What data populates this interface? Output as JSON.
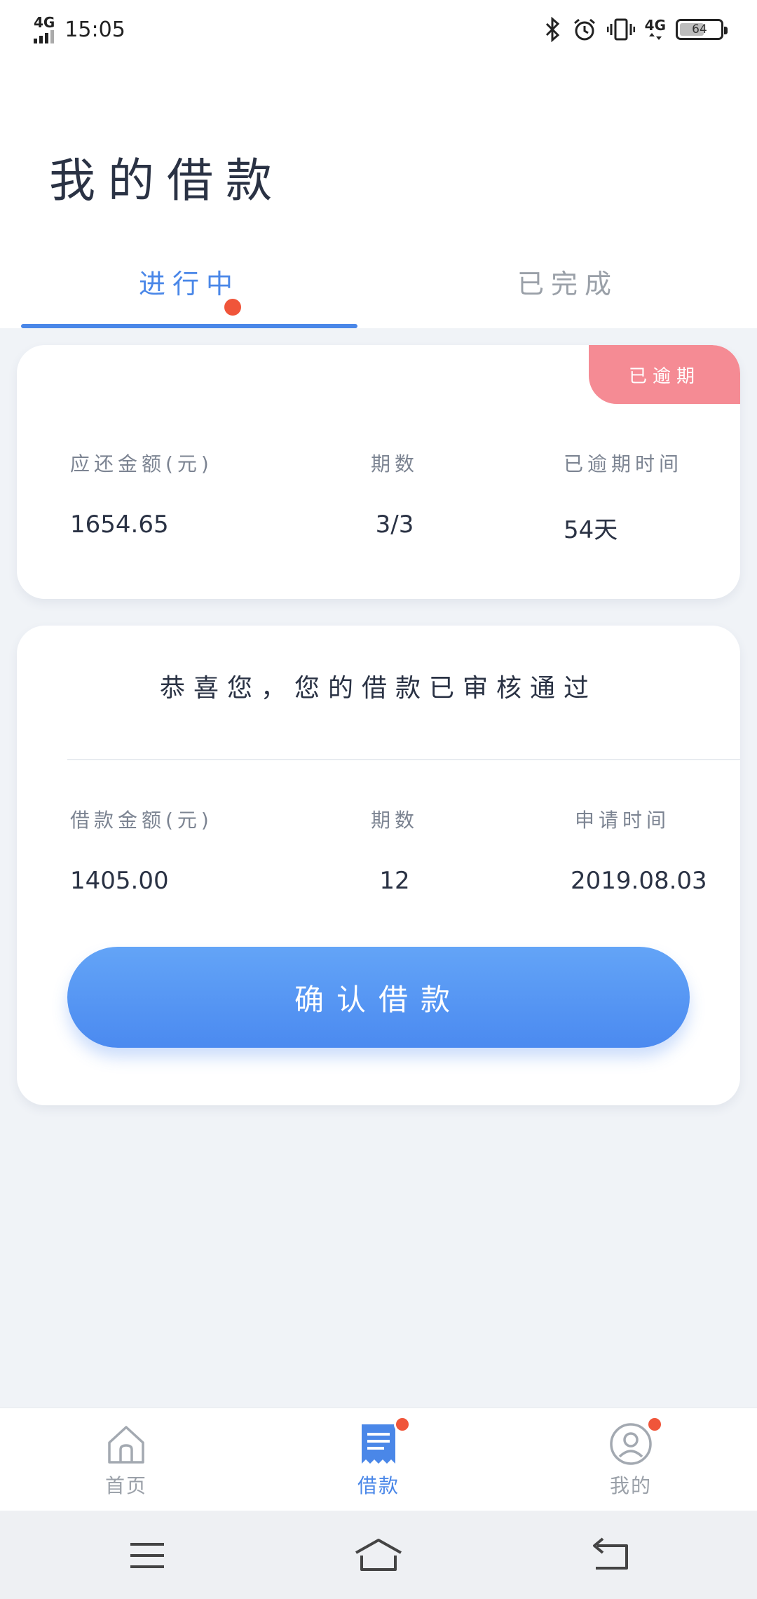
{
  "status_bar": {
    "network": "4G",
    "time": "15:05",
    "network_right": "4G",
    "battery": "64",
    "battery_level": 0.64
  },
  "header": {
    "title": "我的借款",
    "tabs": [
      {
        "label": "进行中",
        "active": true,
        "has_dot": true
      },
      {
        "label": "已完成",
        "active": false,
        "has_dot": false
      }
    ]
  },
  "overdue_card": {
    "badge": "已逾期",
    "columns": [
      {
        "label": "应还金额(元)",
        "value": "1654.65"
      },
      {
        "label": "期数",
        "value": "3/3"
      },
      {
        "label": "已逾期时间",
        "value": "54天"
      }
    ]
  },
  "approved_card": {
    "title": "恭喜您，您的借款已审核通过",
    "columns": [
      {
        "label": "借款金额(元)",
        "value": "1405.00"
      },
      {
        "label": "期数",
        "value": "12"
      },
      {
        "label": "申请时间",
        "value": "2019.08.03"
      }
    ],
    "button_label": "确认借款"
  },
  "bottom_nav": {
    "items": [
      {
        "label": "首页",
        "icon": "home-icon",
        "active": false
      },
      {
        "label": "借款",
        "icon": "loan-document-icon",
        "active": true,
        "has_dot": true
      },
      {
        "label": "我的",
        "icon": "user-profile-icon",
        "active": false,
        "has_dot": true
      }
    ]
  },
  "colors": {
    "accent": "#4a87e8",
    "overdue_badge": "#f58b94",
    "notification_dot": "#f0553a",
    "background": "#f0f3f7"
  }
}
